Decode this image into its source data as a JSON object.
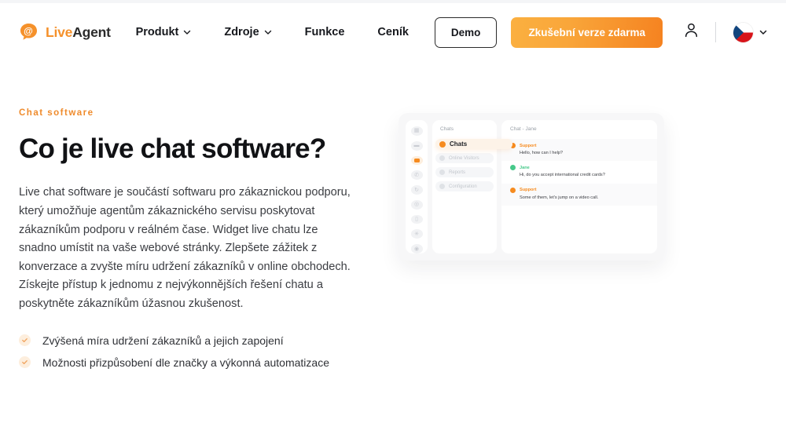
{
  "header": {
    "logo": {
      "icon": "at-speech-bubble-icon",
      "part1": "Live",
      "part2": "Agent"
    },
    "nav": [
      {
        "label": "Produkt",
        "has_chevron": true
      },
      {
        "label": "Zdroje",
        "has_chevron": true
      },
      {
        "label": "Funkce",
        "has_chevron": false
      },
      {
        "label": "Ceník",
        "has_chevron": false
      }
    ],
    "demo_label": "Demo",
    "trial_label": "Zkušební verze zdarma",
    "account_icon": "user-icon",
    "language": {
      "flag": "czech-flag-icon",
      "chevron": "chevron-down-icon"
    }
  },
  "hero": {
    "eyebrow": "Chat software",
    "title": "Co je live chat software?",
    "paragraph": "Live chat software je součástí softwaru pro zákaznickou podporu, který umožňuje agentům zákaznického servisu poskytovat zákazníkům podporu v reálném čase. Widget live chatu lze snadno umístit na vaše webové stránky. Zlepšete zážitek z konverzace a zvyšte míru udržení zákazníků v online obchodech. Získejte přístup k jednomu z nejvýkonnějších řešení chatu a poskytněte zákazníkům úžasnou zkušenost.",
    "bullets": [
      "Zvýšená míra udržení zákazníků a jejich zapojení",
      "Možnosti přizpůsobení dle značky a výkonná automatizace"
    ]
  },
  "mockup": {
    "rail_icons": [
      "dashboard-icon",
      "inbox-icon",
      "chat-icon",
      "phone-icon",
      "refresh-icon",
      "globe-icon",
      "trash-icon",
      "settings-icon",
      "gear-icon"
    ],
    "rail_active_index": 2,
    "panel": {
      "title": "Chats",
      "items": [
        {
          "label": "Chats",
          "active": true
        },
        {
          "label": "Online Visitors",
          "active": false
        },
        {
          "label": "Reports",
          "active": false
        },
        {
          "label": "Configuration",
          "active": false
        }
      ]
    },
    "chat": {
      "title": "Chat - Jane",
      "messages": [
        {
          "author": "Support",
          "color": "#f68b1f",
          "text": "Hello, how can I help?"
        },
        {
          "author": "Jane",
          "color": "#47c98a",
          "text": "Hi, do you accept international credit cards?"
        },
        {
          "author": "Support",
          "color": "#f68b1f",
          "text": "Some of them, let's jump on a video call."
        }
      ]
    }
  },
  "colors": {
    "brand_orange": "#f68b1f",
    "accent_amber": "#fbb040",
    "text_dark": "#16181d",
    "green": "#47c98a"
  }
}
